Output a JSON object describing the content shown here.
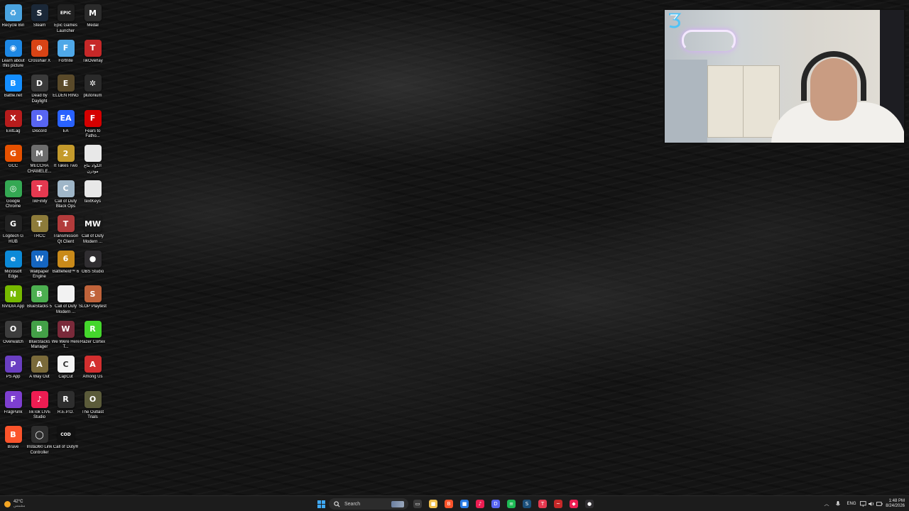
{
  "desktop": {
    "icons": [
      {
        "label": "Recycle Bin",
        "icon": "recycle-bin-icon",
        "color": "#4aa3df",
        "glyph": "♻"
      },
      {
        "label": "Steam",
        "icon": "steam-icon",
        "color": "#1b2838",
        "glyph": "S"
      },
      {
        "label": "Epic Games Launcher",
        "icon": "epic-games-icon",
        "color": "#202020",
        "glyph": "EPIC"
      },
      {
        "label": "Medal",
        "icon": "medal-icon",
        "color": "#2b2b2b",
        "glyph": "M"
      },
      {
        "label": "Learn about this picture",
        "icon": "camera-icon",
        "color": "#1e88e5",
        "glyph": "◉"
      },
      {
        "label": "Crosshair X",
        "icon": "crosshair-icon",
        "color": "#d84315",
        "glyph": "⊕"
      },
      {
        "label": "Fortnite",
        "icon": "fortnite-icon",
        "color": "#4fa8e8",
        "glyph": "F"
      },
      {
        "label": "TikOverlay",
        "icon": "tikoverlay-icon",
        "color": "#c62828",
        "glyph": "T"
      },
      {
        "label": "Battle.net",
        "icon": "battlenet-icon",
        "color": "#148eff",
        "glyph": "B"
      },
      {
        "label": "Dead by Daylight",
        "icon": "dead-by-daylight-icon",
        "color": "#3a3a3a",
        "glyph": "D"
      },
      {
        "label": "ELDEN RING",
        "icon": "elden-ring-icon",
        "color": "#5a4a2a",
        "glyph": "E"
      },
      {
        "label": "plutonium",
        "icon": "plutonium-icon",
        "color": "#2a2a2a",
        "glyph": "✲"
      },
      {
        "label": "ExitLag",
        "icon": "exitlag-icon",
        "color": "#b71c1c",
        "glyph": "X"
      },
      {
        "label": "Discord",
        "icon": "discord-icon",
        "color": "#5865f2",
        "glyph": "D"
      },
      {
        "label": "EA",
        "icon": "ea-icon",
        "color": "#2962ff",
        "glyph": "EA"
      },
      {
        "label": "Fears to Fatho...",
        "icon": "fears-to-fathom-icon",
        "color": "#d50000",
        "glyph": "F"
      },
      {
        "label": "GCC",
        "icon": "gcc-icon",
        "color": "#e65100",
        "glyph": "G"
      },
      {
        "label": "MECCHA CHAMELE...",
        "icon": "meccha-chameleon-icon",
        "color": "#6d6d6d",
        "glyph": "M"
      },
      {
        "label": "It Takes Two",
        "icon": "it-takes-two-icon",
        "color": "#c49a2c",
        "glyph": "2"
      },
      {
        "label": "الكواد بتاع مودرن",
        "icon": "text-file-icon",
        "color": "#e8e8e8",
        "glyph": ""
      },
      {
        "label": "Google Chrome",
        "icon": "chrome-icon",
        "color": "#34a853",
        "glyph": "◎"
      },
      {
        "label": "TikFinity",
        "icon": "tikfinity-icon",
        "color": "#e53950",
        "glyph": "T"
      },
      {
        "label": "Call of Duty Black Ops",
        "icon": "black-ops-icon",
        "color": "#9fb6c8",
        "glyph": "C"
      },
      {
        "label": "textKeys",
        "icon": "text-file-icon",
        "color": "#e8e8e8",
        "glyph": ""
      },
      {
        "label": "Logitech G HUB",
        "icon": "logitech-icon",
        "color": "#222222",
        "glyph": "G"
      },
      {
        "label": "TRCC",
        "icon": "trcc-icon",
        "color": "#8d7b3a",
        "glyph": "T"
      },
      {
        "label": "Transmission Qt Client",
        "icon": "transmission-icon",
        "color": "#b23b3b",
        "glyph": "T"
      },
      {
        "label": "Call of Duty Modern ...",
        "icon": "modern-warfare-icon",
        "color": "#1a1a1a",
        "glyph": "MW"
      },
      {
        "label": "Microsoft Edge",
        "icon": "edge-icon",
        "color": "#0c8ad8",
        "glyph": "e"
      },
      {
        "label": "Wallpaper Engine",
        "icon": "wallpaper-engine-icon",
        "color": "#1565c0",
        "glyph": "W"
      },
      {
        "label": "Battlefield™ 6",
        "icon": "battlefield-icon",
        "color": "#c98a1a",
        "glyph": "6"
      },
      {
        "label": "OBS Studio",
        "icon": "obs-icon",
        "color": "#302e31",
        "glyph": "●"
      },
      {
        "label": "NVIDIA App",
        "icon": "nvidia-icon",
        "color": "#76b900",
        "glyph": "N"
      },
      {
        "label": "BlueStacks 5",
        "icon": "bluestacks-icon",
        "color": "#4caf50",
        "glyph": "B"
      },
      {
        "label": "Call of Duty Modern ...",
        "icon": "text-file-icon",
        "color": "#f2f2f2",
        "glyph": ""
      },
      {
        "label": "SLOP Playtest",
        "icon": "slop-icon",
        "color": "#c0633a",
        "glyph": "S"
      },
      {
        "label": "Overwatch",
        "icon": "overwatch-icon",
        "color": "#3d3d3d",
        "glyph": "O"
      },
      {
        "label": "BlueStacks Manager",
        "icon": "bluestacks-manager-icon",
        "color": "#43a047",
        "glyph": "B"
      },
      {
        "label": "We Were Here T...",
        "icon": "we-were-here-icon",
        "color": "#7a2a3a",
        "glyph": "W"
      },
      {
        "label": "Razer Cortex",
        "icon": "razer-cortex-icon",
        "color": "#44d62c",
        "glyph": "R"
      },
      {
        "label": "PS App",
        "icon": "playstation-icon",
        "color": "#6a3fc2",
        "glyph": "P"
      },
      {
        "label": "A Way Out",
        "icon": "a-way-out-icon",
        "color": "#7a6a3a",
        "glyph": "A"
      },
      {
        "label": "CapCut",
        "icon": "capcut-icon",
        "color": "#f5f5f5",
        "glyph": "C"
      },
      {
        "label": "Among Us",
        "icon": "among-us-icon",
        "color": "#d32f2f",
        "glyph": "A"
      },
      {
        "label": "FragPunk",
        "icon": "fragpunk-icon",
        "color": "#7e3fd0",
        "glyph": "F"
      },
      {
        "label": "TikTok LIVE Studio",
        "icon": "tiktok-live-icon",
        "color": "#ee1d52",
        "glyph": "♪"
      },
      {
        "label": "R.E.P.O.",
        "icon": "repo-icon",
        "color": "#2e2e2e",
        "glyph": "R"
      },
      {
        "label": "The Outlast Trials",
        "icon": "outlast-trials-icon",
        "color": "#5b5b3a",
        "glyph": "O"
      },
      {
        "label": "Brave",
        "icon": "brave-icon",
        "color": "#fb542b",
        "glyph": "B"
      },
      {
        "label": "Insta360 Link Controller",
        "icon": "insta360-icon",
        "color": "#2e2e2e",
        "glyph": "◯"
      },
      {
        "label": "Call of Duty®",
        "icon": "call-of-duty-icon",
        "color": "#111111",
        "glyph": "COD"
      }
    ]
  },
  "taskbar": {
    "weather": {
      "temp": "42°C",
      "condition": "مشمس",
      "icon": "sun-icon"
    },
    "start_icon": "windows-start-icon",
    "search_placeholder": "Search",
    "apps": [
      {
        "icon": "task-view-icon",
        "color": "#3a3a3a",
        "glyph": "▭"
      },
      {
        "icon": "file-explorer-icon",
        "color": "#f2c14e",
        "glyph": "■"
      },
      {
        "icon": "brave-icon",
        "color": "#fb542b",
        "glyph": "B"
      },
      {
        "icon": "microsoft-store-icon",
        "color": "#2a7be4",
        "glyph": "■"
      },
      {
        "icon": "tiktok-icon",
        "color": "#ee1d52",
        "glyph": "♪"
      },
      {
        "icon": "discord-icon",
        "color": "#5865f2",
        "glyph": "D"
      },
      {
        "icon": "spotify-icon",
        "color": "#1db954",
        "glyph": "≡"
      },
      {
        "icon": "steam-icon",
        "color": "#1b4f7a",
        "glyph": "S"
      },
      {
        "icon": "tikfinity-icon",
        "color": "#e53950",
        "glyph": "T"
      },
      {
        "icon": "tikoverlay-icon",
        "color": "#c62828",
        "glyph": "~"
      },
      {
        "icon": "tiktok-live-icon",
        "color": "#ee1d52",
        "glyph": "◆"
      },
      {
        "icon": "obs-icon",
        "color": "#302e31",
        "glyph": "●"
      }
    ],
    "tray": {
      "chevron_icon": "chevron-up-icon",
      "mic_icon": "microphone-icon",
      "language": "ENG",
      "network_icon": "network-icon",
      "volume_icon": "volume-icon",
      "battery_icon": "battery-icon",
      "time": "1:48 PM",
      "date": "8/24/2026",
      "notification_icon": "notification-bell-icon"
    }
  },
  "webcam": {
    "label": "webcam-overlay"
  }
}
